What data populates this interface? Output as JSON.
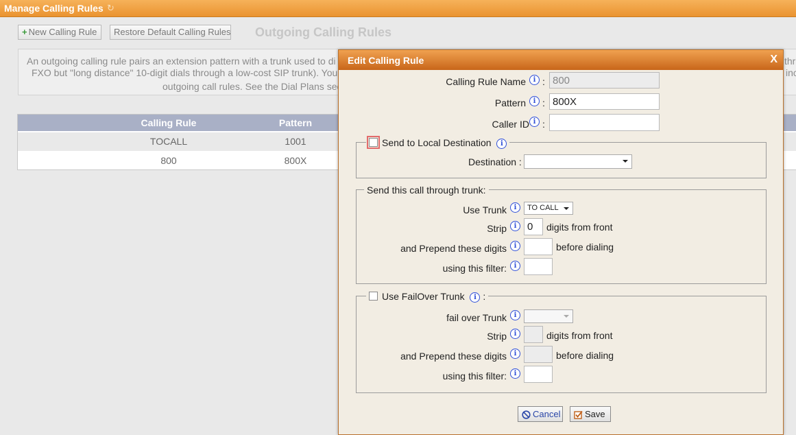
{
  "header": {
    "title": "Manage Calling Rules",
    "refresh_icon": "refresh-icon"
  },
  "toolbar": {
    "new_rule_label": "New Calling Rule",
    "restore_label": "Restore Default Calling Rules",
    "section_title": "Outgoing Calling Rules"
  },
  "info_text": {
    "line1": "An outgoing calling rule pairs an extension pattern with a trunk used to di",
    "line1_right": "thr",
    "line2": "FXO but \"long distance\" 10-digit dials through a low-cost SIP trunk). You",
    "line2_right": "inc",
    "line3": "outgoing call rules. See the Dial Plans sect"
  },
  "table": {
    "columns": [
      "Calling Rule",
      "Pattern"
    ],
    "rows": [
      [
        "TOCALL",
        "1001"
      ],
      [
        "800",
        "800X"
      ]
    ]
  },
  "dialog": {
    "title": "Edit Calling Rule",
    "close_label": "X",
    "rule_name_label": "Calling Rule Name",
    "rule_name_value": "800",
    "pattern_label": "Pattern",
    "pattern_value": "800X",
    "callerid_label": "Caller ID",
    "callerid_value": "",
    "local_dest": {
      "legend": "Send to Local Destination",
      "checked": false,
      "destination_label": "Destination :",
      "destination_value": ""
    },
    "trunk": {
      "legend": "Send this call through trunk:",
      "use_trunk_label": "Use Trunk",
      "use_trunk_value": "TO CALL",
      "strip_label": "Strip",
      "strip_value": "0",
      "strip_suffix": "digits from front",
      "prepend_label": "and Prepend these digits",
      "prepend_value": "",
      "prepend_suffix": "before dialing",
      "filter_label": "using this filter:",
      "filter_value": ""
    },
    "failover": {
      "legend": "Use FailOver Trunk",
      "checked": false,
      "trunk_label": "fail over Trunk",
      "trunk_value": "",
      "strip_label": "Strip",
      "strip_value": "",
      "strip_suffix": "digits from front",
      "prepend_label": "and Prepend these digits",
      "prepend_value": "",
      "prepend_suffix": "before dialing",
      "filter_label": "using this filter:",
      "filter_value": ""
    },
    "cancel_label": "Cancel",
    "save_label": "Save"
  },
  "colors": {
    "header_orange": "#ea9330",
    "dialog_bg": "#f2ede3",
    "info_icon_blue": "#2f4fd8",
    "table_header": "#a9b0c6"
  }
}
